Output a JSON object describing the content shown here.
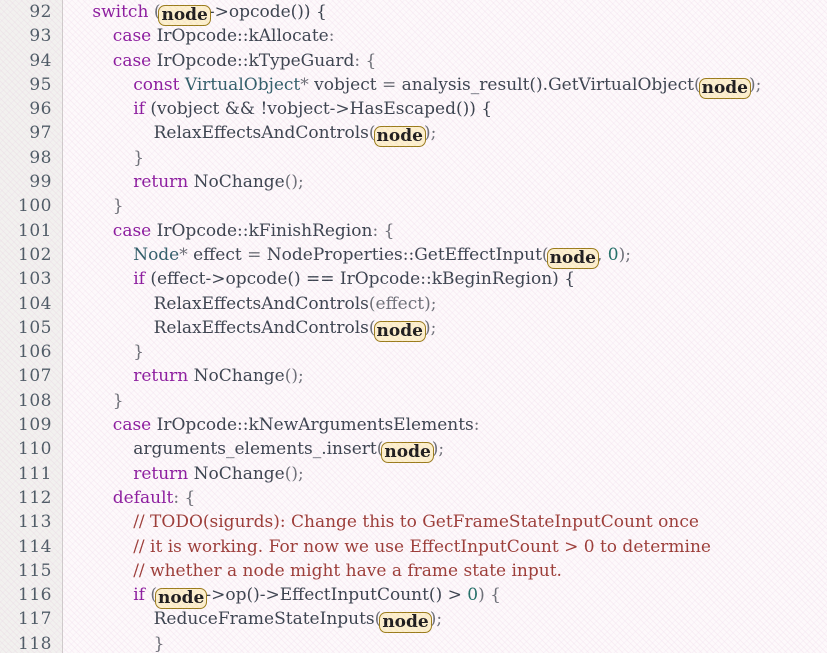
{
  "editor": {
    "name": "code-viewer",
    "language": "cpp",
    "first_line": 92,
    "last_line": 118,
    "highlight_token": "node",
    "colors": {
      "background": "#fdf9fb",
      "gutter_background": "#f2f1ef",
      "gutter_rule": "#cfcccb",
      "line_number": "#4c5a64",
      "default_text": "#2f3b46",
      "keyword": "#8b1a9e",
      "type": "#2f5d68",
      "identifier": "#39424d",
      "number": "#1f6f66",
      "punctuation": "#6b6f76",
      "comment": "#9b3b35",
      "highlight_fill": "#fdf1cd",
      "highlight_border": "#9a7c18",
      "highlight_text": "#1b1b1b"
    }
  },
  "lines": [
    {
      "number": "92",
      "indent": 2,
      "tokens": [
        {
          "t": "switch ",
          "c": "kw"
        },
        {
          "t": "(",
          "c": "pun"
        },
        {
          "t": "node",
          "c": "hl"
        },
        {
          "t": "->opcode()) {",
          "c": "id"
        }
      ]
    },
    {
      "number": "93",
      "indent": 4,
      "tokens": [
        {
          "t": "case ",
          "c": "kw"
        },
        {
          "t": "IrOpcode::kAllocate",
          "c": "id"
        },
        {
          "t": ":",
          "c": "pun"
        }
      ]
    },
    {
      "number": "94",
      "indent": 4,
      "tokens": [
        {
          "t": "case ",
          "c": "kw"
        },
        {
          "t": "IrOpcode::kTypeGuard",
          "c": "id"
        },
        {
          "t": ": {",
          "c": "pun"
        }
      ]
    },
    {
      "number": "95",
      "indent": 6,
      "tokens": [
        {
          "t": "const ",
          "c": "kw"
        },
        {
          "t": "VirtualObject",
          "c": "typ"
        },
        {
          "t": "* ",
          "c": "pun"
        },
        {
          "t": "vobject ",
          "c": "id"
        },
        {
          "t": "= ",
          "c": "pun"
        },
        {
          "t": "analysis_result().GetVirtualObject",
          "c": "id"
        },
        {
          "t": "(",
          "c": "pun"
        },
        {
          "t": "node",
          "c": "hl"
        },
        {
          "t": ");",
          "c": "pun"
        }
      ]
    },
    {
      "number": "96",
      "indent": 6,
      "tokens": [
        {
          "t": "if ",
          "c": "kw"
        },
        {
          "t": "(vobject && !vobject->HasEscaped()) {",
          "c": "id"
        }
      ]
    },
    {
      "number": "97",
      "indent": 8,
      "tokens": [
        {
          "t": "RelaxEffectsAndControls",
          "c": "id"
        },
        {
          "t": "(",
          "c": "pun"
        },
        {
          "t": "node",
          "c": "hl"
        },
        {
          "t": ");",
          "c": "pun"
        }
      ]
    },
    {
      "number": "98",
      "indent": 6,
      "tokens": [
        {
          "t": "}",
          "c": "pun"
        }
      ]
    },
    {
      "number": "99",
      "indent": 6,
      "tokens": [
        {
          "t": "return ",
          "c": "kw"
        },
        {
          "t": "NoChange",
          "c": "id"
        },
        {
          "t": "();",
          "c": "pun"
        }
      ]
    },
    {
      "number": "100",
      "indent": 4,
      "tokens": [
        {
          "t": "}",
          "c": "pun"
        }
      ]
    },
    {
      "number": "101",
      "indent": 4,
      "tokens": [
        {
          "t": "case ",
          "c": "kw"
        },
        {
          "t": "IrOpcode::kFinishRegion",
          "c": "id"
        },
        {
          "t": ": {",
          "c": "pun"
        }
      ]
    },
    {
      "number": "102",
      "indent": 6,
      "tokens": [
        {
          "t": "Node",
          "c": "typ"
        },
        {
          "t": "* ",
          "c": "pun"
        },
        {
          "t": "effect ",
          "c": "id"
        },
        {
          "t": "= ",
          "c": "pun"
        },
        {
          "t": "NodeProperties::GetEffectInput",
          "c": "id"
        },
        {
          "t": "(",
          "c": "pun"
        },
        {
          "t": "node",
          "c": "hl"
        },
        {
          "t": ", ",
          "c": "pun"
        },
        {
          "t": "0",
          "c": "num"
        },
        {
          "t": ");",
          "c": "pun"
        }
      ]
    },
    {
      "number": "103",
      "indent": 6,
      "tokens": [
        {
          "t": "if ",
          "c": "kw"
        },
        {
          "t": "(effect->opcode() == IrOpcode::kBeginRegion) {",
          "c": "id"
        }
      ]
    },
    {
      "number": "104",
      "indent": 8,
      "tokens": [
        {
          "t": "RelaxEffectsAndControls",
          "c": "id"
        },
        {
          "t": "(effect);",
          "c": "pun"
        }
      ]
    },
    {
      "number": "105",
      "indent": 8,
      "tokens": [
        {
          "t": "RelaxEffectsAndControls",
          "c": "id"
        },
        {
          "t": "(",
          "c": "pun"
        },
        {
          "t": "node",
          "c": "hl"
        },
        {
          "t": ");",
          "c": "pun"
        }
      ]
    },
    {
      "number": "106",
      "indent": 6,
      "tokens": [
        {
          "t": "}",
          "c": "pun"
        }
      ]
    },
    {
      "number": "107",
      "indent": 6,
      "tokens": [
        {
          "t": "return ",
          "c": "kw"
        },
        {
          "t": "NoChange",
          "c": "id"
        },
        {
          "t": "();",
          "c": "pun"
        }
      ]
    },
    {
      "number": "108",
      "indent": 4,
      "tokens": [
        {
          "t": "}",
          "c": "pun"
        }
      ]
    },
    {
      "number": "109",
      "indent": 4,
      "tokens": [
        {
          "t": "case ",
          "c": "kw"
        },
        {
          "t": "IrOpcode::kNewArgumentsElements",
          "c": "id"
        },
        {
          "t": ":",
          "c": "pun"
        }
      ]
    },
    {
      "number": "110",
      "indent": 6,
      "tokens": [
        {
          "t": "arguments_elements_.insert",
          "c": "id"
        },
        {
          "t": "(",
          "c": "pun"
        },
        {
          "t": "node",
          "c": "hl"
        },
        {
          "t": ");",
          "c": "pun"
        }
      ]
    },
    {
      "number": "111",
      "indent": 6,
      "tokens": [
        {
          "t": "return ",
          "c": "kw"
        },
        {
          "t": "NoChange",
          "c": "id"
        },
        {
          "t": "();",
          "c": "pun"
        }
      ]
    },
    {
      "number": "112",
      "indent": 4,
      "tokens": [
        {
          "t": "default",
          "c": "kw"
        },
        {
          "t": ": {",
          "c": "pun"
        }
      ]
    },
    {
      "number": "113",
      "indent": 6,
      "tokens": [
        {
          "t": "// TODO(sigurds): Change this to GetFrameStateInputCount once",
          "c": "cmt"
        }
      ]
    },
    {
      "number": "114",
      "indent": 6,
      "tokens": [
        {
          "t": "// it is working. For now we use EffectInputCount > 0 to determine",
          "c": "cmt"
        }
      ]
    },
    {
      "number": "115",
      "indent": 6,
      "tokens": [
        {
          "t": "// whether a node might have a frame state input.",
          "c": "cmt"
        }
      ]
    },
    {
      "number": "116",
      "indent": 6,
      "tokens": [
        {
          "t": "if ",
          "c": "kw"
        },
        {
          "t": "(",
          "c": "pun"
        },
        {
          "t": "node",
          "c": "hl"
        },
        {
          "t": "->op()->EffectInputCount() > ",
          "c": "id"
        },
        {
          "t": "0",
          "c": "num"
        },
        {
          "t": ") {",
          "c": "pun"
        }
      ]
    },
    {
      "number": "117",
      "indent": 8,
      "tokens": [
        {
          "t": "ReduceFrameStateInputs",
          "c": "id"
        },
        {
          "t": "(",
          "c": "pun"
        },
        {
          "t": "node",
          "c": "hl"
        },
        {
          "t": ");",
          "c": "pun"
        }
      ]
    },
    {
      "number": "118",
      "indent": 8,
      "tokens": [
        {
          "t": "}",
          "c": "pun"
        }
      ]
    }
  ]
}
